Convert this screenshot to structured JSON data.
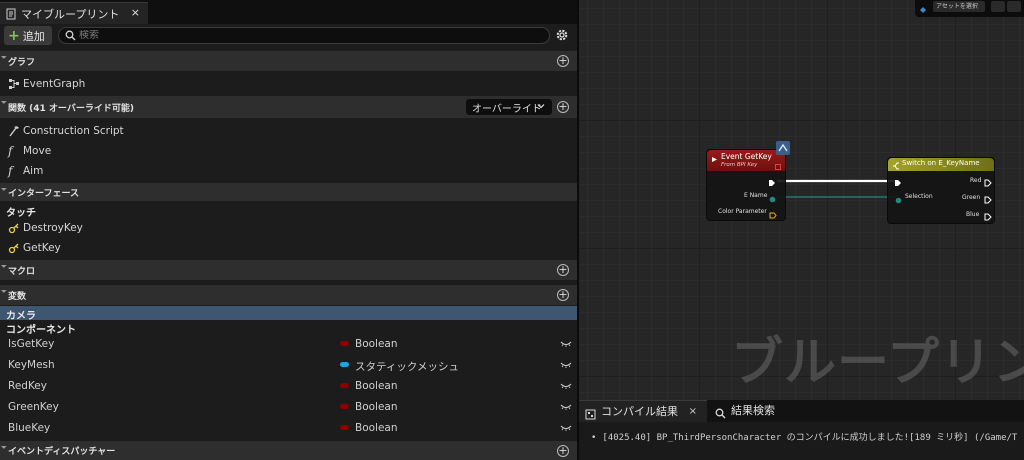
{
  "my_blueprint": {
    "tab_title": "マイブループリント",
    "tab_close": "×",
    "add_label": "追加",
    "search_placeholder": "検索",
    "sections": {
      "graphs": "グラフ",
      "functions": "関数 (41 オーバーライド可能)",
      "interfaces": "インターフェース",
      "macros": "マクロ",
      "variables": "変数",
      "event_dispatchers": "イベントディスパッチャー"
    },
    "override_label": "オーバーライド",
    "graph_items": [
      "EventGraph"
    ],
    "function_items": [
      "Construction Script",
      "Move",
      "Aim"
    ],
    "interface_category": "タッチ",
    "interface_items": [
      "DestroyKey",
      "GetKey"
    ],
    "variable_categories": [
      "カメラ",
      "コンポーネント"
    ],
    "variables": [
      {
        "name": "IsGetKey",
        "type": "Boolean",
        "color": "#8c0000"
      },
      {
        "name": "KeyMesh",
        "type": "スタティックメッシュ",
        "color": "#1aa6e6"
      },
      {
        "name": "RedKey",
        "type": "Boolean",
        "color": "#8c0000"
      },
      {
        "name": "GreenKey",
        "type": "Boolean",
        "color": "#8c0000"
      },
      {
        "name": "BlueKey",
        "type": "Boolean",
        "color": "#8c0000"
      }
    ]
  },
  "graph": {
    "toolbar_dropdown": "アセットを選択",
    "watermark": "ブループリント",
    "event_node": {
      "title": "Event GetKey",
      "subtitle": "From BPI Key",
      "pins": [
        "E Name",
        "Color Parameter"
      ],
      "header_color": "#8a1414"
    },
    "switch_node": {
      "title": "Switch on E_KeyName",
      "input_pin": "Selection",
      "outputs": [
        "Red",
        "Green",
        "Blue"
      ],
      "header_color": "#8c8c1c"
    }
  },
  "compiler": {
    "tab_results": "コンパイル結果",
    "tab_search": "結果検索",
    "tab_close": "×",
    "message": "[4025.40] BP_ThirdPersonCharacter のコンパイルに成功しました![189 ミリ秒] (/Game/T"
  }
}
